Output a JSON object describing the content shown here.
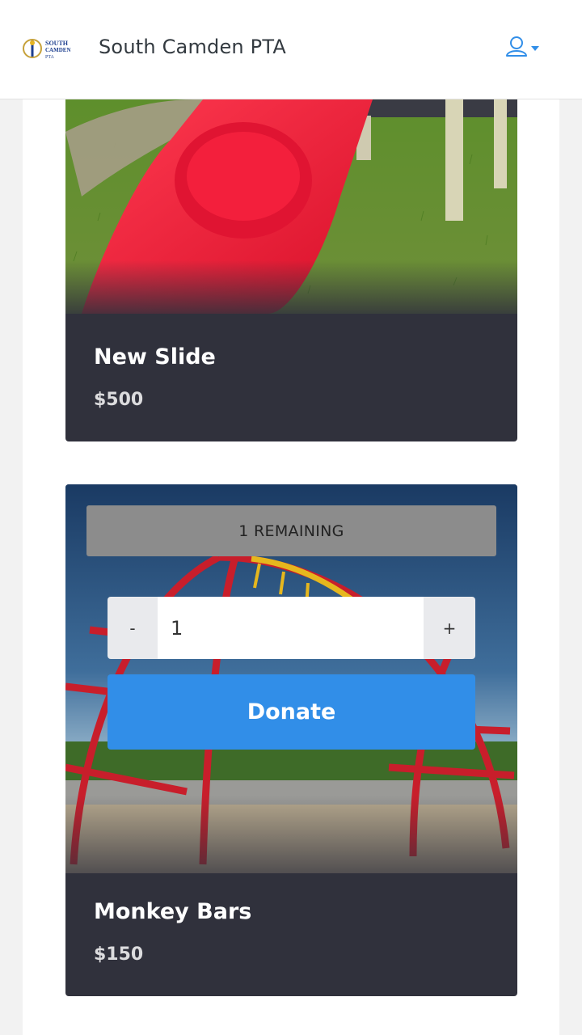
{
  "header": {
    "logo_text": [
      "SOUTH",
      "CAMDEN",
      "PTA"
    ],
    "org_name": "South Camden PTA",
    "user_icon": "user-icon",
    "menu_caret_icon": "caret-down-icon",
    "accent_color": "#318ee8"
  },
  "items": [
    {
      "title": "New Slide",
      "price": "$500",
      "image": "red-slide-photo"
    },
    {
      "title": "Monkey Bars",
      "price": "$150",
      "image": "monkey-bars-photo",
      "remaining_label": "1 REMAINING",
      "quantity": {
        "minus_label": "-",
        "value": "1",
        "plus_label": "+"
      },
      "donate_label": "Donate"
    }
  ]
}
